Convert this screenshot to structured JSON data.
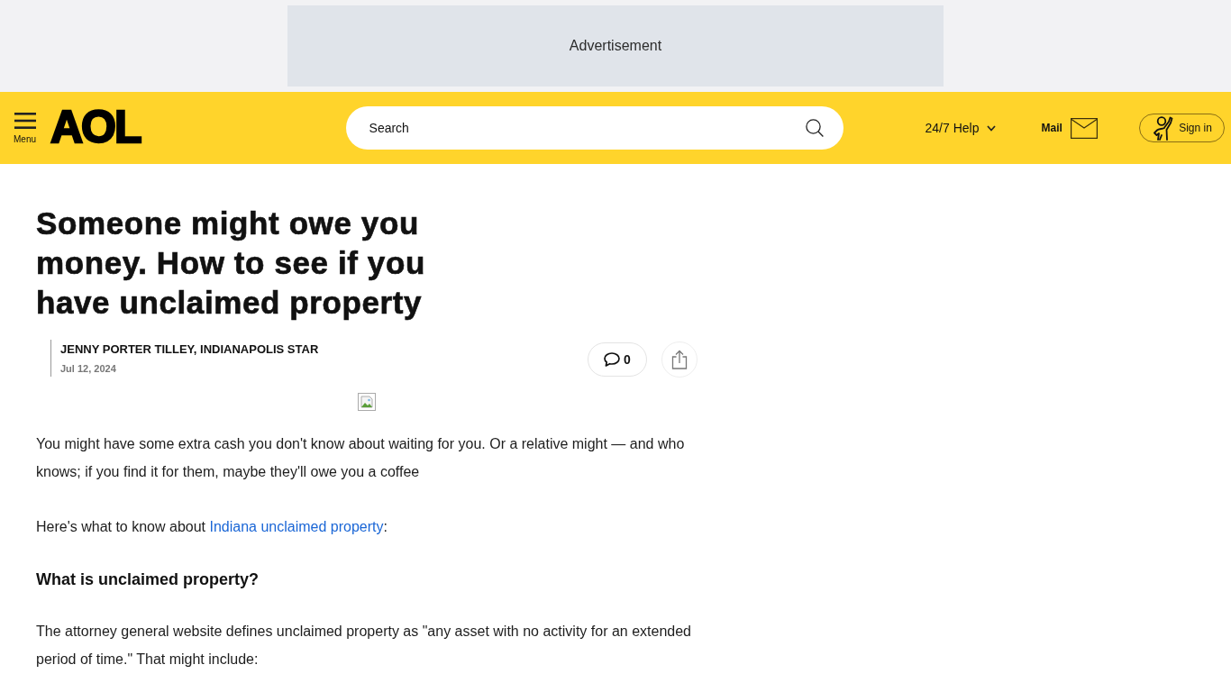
{
  "advertisement": "Advertisement",
  "header": {
    "menu_label": "Menu",
    "logo": "AOL",
    "search": {
      "placeholder": "Search"
    },
    "help_label": "24/7 Help",
    "mail_label": "Mail",
    "sign_in_label": "Sign in"
  },
  "article": {
    "title": "Someone might owe you money. How to see if you have unclaimed property",
    "author": "JENNY PORTER TILLEY, INDIANAPOLIS STAR",
    "date": "Jul 12, 2024",
    "comment_count": "0",
    "body": [
      {
        "kind": "paragraph",
        "segments": [
          {
            "kind": "text",
            "text": "You might have some extra cash you don't know about waiting for you. Or a relative might — and who knows; if you find it for them, maybe they'll owe you a coffee"
          }
        ]
      },
      {
        "kind": "paragraph",
        "segments": [
          {
            "kind": "text",
            "text": "Here's what to know about "
          },
          {
            "kind": "link",
            "text": "Indiana unclaimed property"
          },
          {
            "kind": "text",
            "text": ":"
          }
        ]
      },
      {
        "kind": "heading",
        "text": "What is unclaimed property?"
      },
      {
        "kind": "paragraph",
        "segments": [
          {
            "kind": "text",
            "text": "The attorney general website defines unclaimed property as \"any asset with no activity for an extended period of time.\" That might include:"
          }
        ]
      }
    ]
  }
}
